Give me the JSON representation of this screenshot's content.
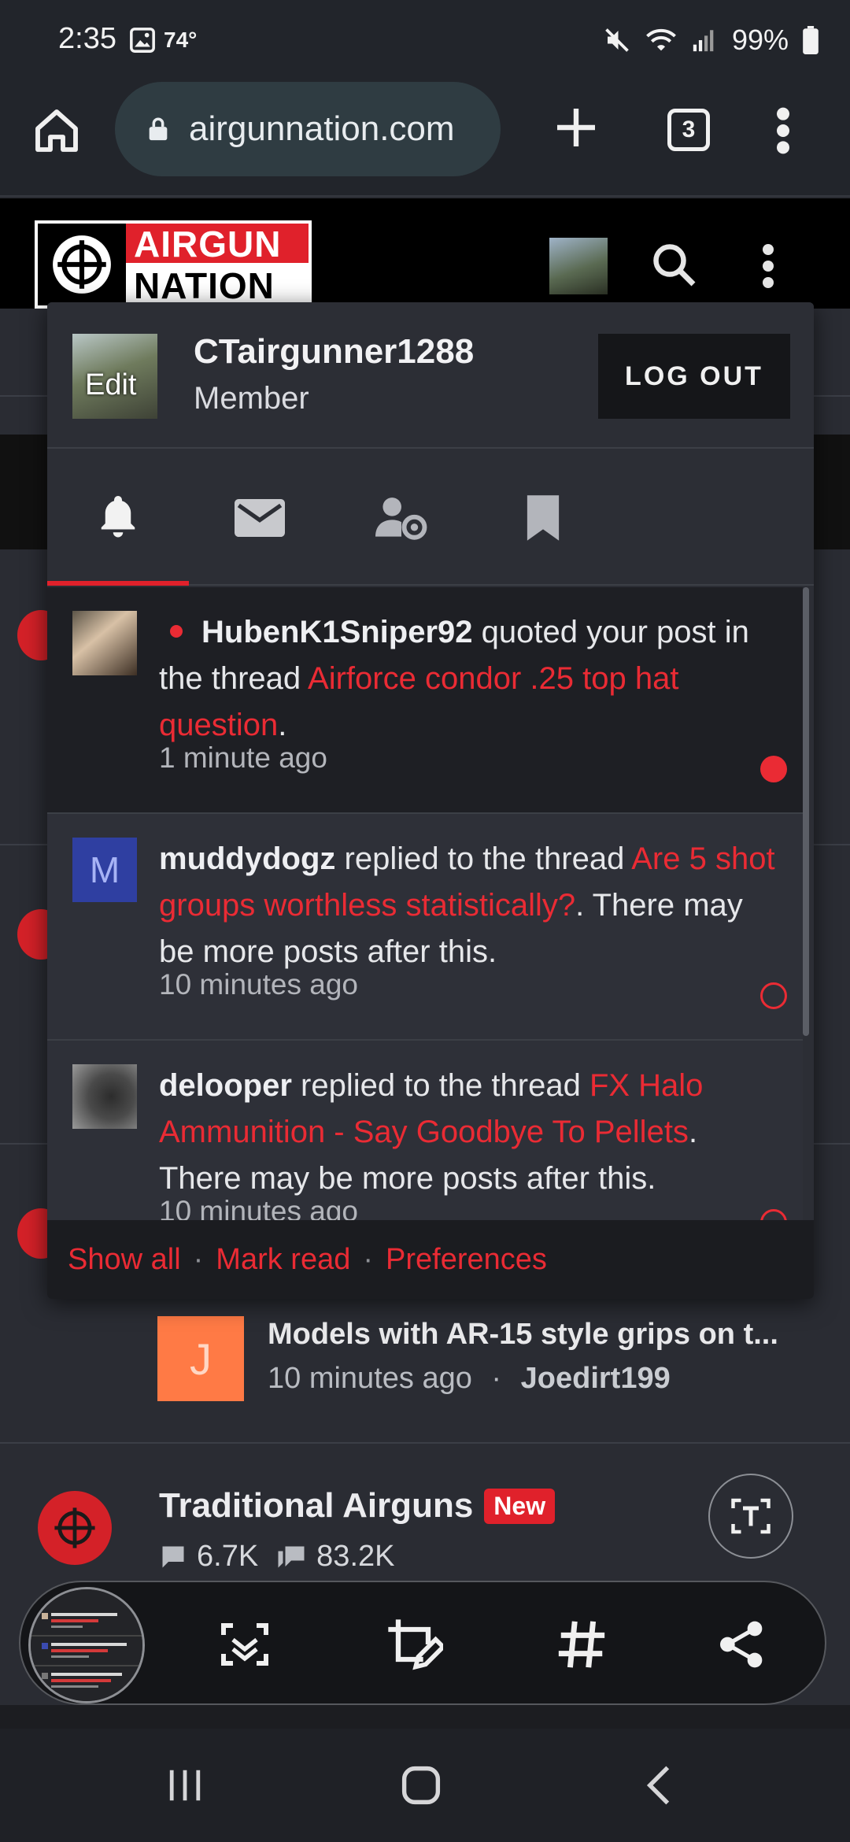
{
  "status_bar": {
    "time": "2:35",
    "temperature": "74°",
    "battery": "99%",
    "icons": [
      "gallery-icon",
      "mute-icon",
      "wifi-icon",
      "signal-icon",
      "battery-icon"
    ]
  },
  "browser": {
    "url": "airgunnation.com",
    "tab_count": "3"
  },
  "site": {
    "logo_line1": "AIRGUN",
    "logo_line2": "NATION",
    "brand_red": "#e0212b"
  },
  "popup": {
    "username": "CTairgunner1288",
    "role": "Member",
    "avatar_edit": "Edit",
    "logout": "LOG OUT",
    "tabs": [
      {
        "icon": "bell-icon",
        "active": true
      },
      {
        "icon": "envelope-icon",
        "active": false
      },
      {
        "icon": "user-settings-icon",
        "active": false
      },
      {
        "icon": "bookmark-icon",
        "active": false
      }
    ],
    "notifications": [
      {
        "user": "HubenK1Sniper92",
        "action": " quoted your post in the thread ",
        "thread": "Airforce condor .25 top hat question",
        "suffix": ".",
        "time": "1 minute ago",
        "unread": true
      },
      {
        "avatar_letter": "M",
        "user": "muddydogz",
        "action": " replied to the thread ",
        "thread": "Are 5 shot groups worthless statistically?",
        "suffix": ". There may be more posts after this.",
        "time": "10 minutes ago",
        "unread": false
      },
      {
        "user": "delooper",
        "action": " replied to the thread ",
        "thread": "FX Halo Ammunition - Say Goodbye To Pellets",
        "suffix": ". There may be more posts after this.",
        "time": "10 minutes ago",
        "unread": false
      }
    ],
    "footer": {
      "show_all": "Show all",
      "separator": "·",
      "mark_read": "Mark read",
      "preferences": "Preferences"
    }
  },
  "background": {
    "thread": {
      "thumb_letter": "J",
      "title": "Models with AR-15 style grips on t...",
      "time": "10 minutes ago",
      "separator": "·",
      "author": "Joedirt199"
    },
    "forum": {
      "title": "Traditional Airguns",
      "badge": "New",
      "threads": "6.7K",
      "messages": "83.2K"
    }
  },
  "smart_select": {
    "icons": [
      "scan-text-icon",
      "crop-edit-icon",
      "hashtag-icon",
      "share-icon"
    ]
  },
  "nav": {
    "icons": [
      "recents-icon",
      "home-icon",
      "back-icon"
    ]
  }
}
